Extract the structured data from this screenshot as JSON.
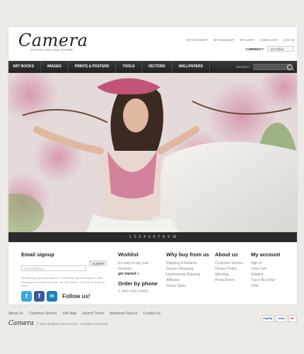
{
  "header": {
    "logo": "Camera",
    "tagline": "PHOTO ONLINE STORE",
    "top_links": [
      "My Account",
      "My Wishlist",
      "My Cart",
      "Checkout",
      "Log In"
    ],
    "currency_label": "Currency:",
    "currency_value": "US Dollar"
  },
  "nav": {
    "items": [
      "Art Books",
      "Images",
      "Prints & Posters",
      "Tools",
      "Vectors",
      "Wallpapers"
    ],
    "search_label": "Search:"
  },
  "slider": {
    "prev": "‹",
    "pages": [
      "1",
      "2",
      "3",
      "4",
      "5",
      "6",
      "7",
      "8",
      "9",
      "10"
    ],
    "next": "›"
  },
  "footer": {
    "email": {
      "title": "Email signup",
      "placeholder": "email address",
      "submit": "Submit",
      "text": "By entering my email address, I certify that the information I have provided is accurate and true. You will receive 10 more of what you need.",
      "follow": "Follow us!"
    },
    "wishlist": {
      "title": "Wishlist",
      "text": "It's easy to tag your favorites.",
      "link": "get started »"
    },
    "order": {
      "title": "Order by phone",
      "phone": "1-800-000-0000"
    },
    "why": {
      "title": "Why buy from us",
      "links": [
        "Shipping & Returns",
        "Secure Shopping",
        "International Shipping",
        "Affiliates",
        "Group Sales"
      ]
    },
    "about": {
      "title": "About us",
      "links": [
        "Customer Service",
        "Privacy Policy",
        "Site Map",
        "Press Room"
      ]
    },
    "account": {
      "title": "My account",
      "links": [
        "Sign In",
        "View Cart",
        "Wishlist",
        "Track My Order",
        "Help"
      ]
    }
  },
  "bottom": {
    "links": [
      "About Us",
      "Customer Service",
      "Site Map",
      "Search Terms",
      "Advanced Search",
      "Contact Us"
    ],
    "logo": "Camera",
    "copyright": "© 2013 Magento Demo Store. All Rights Reserved.",
    "payment": [
      "PayPal",
      "VISA",
      "MC"
    ]
  },
  "social": {
    "twitter": "t",
    "facebook": "f",
    "linkedin": "in"
  },
  "colors": {
    "nav_bg": "#2c2c2c",
    "page_bg": "#ecebe6",
    "twitter": "#3aa9dc",
    "facebook": "#3b5a9a",
    "linkedin": "#1b7fb2"
  }
}
